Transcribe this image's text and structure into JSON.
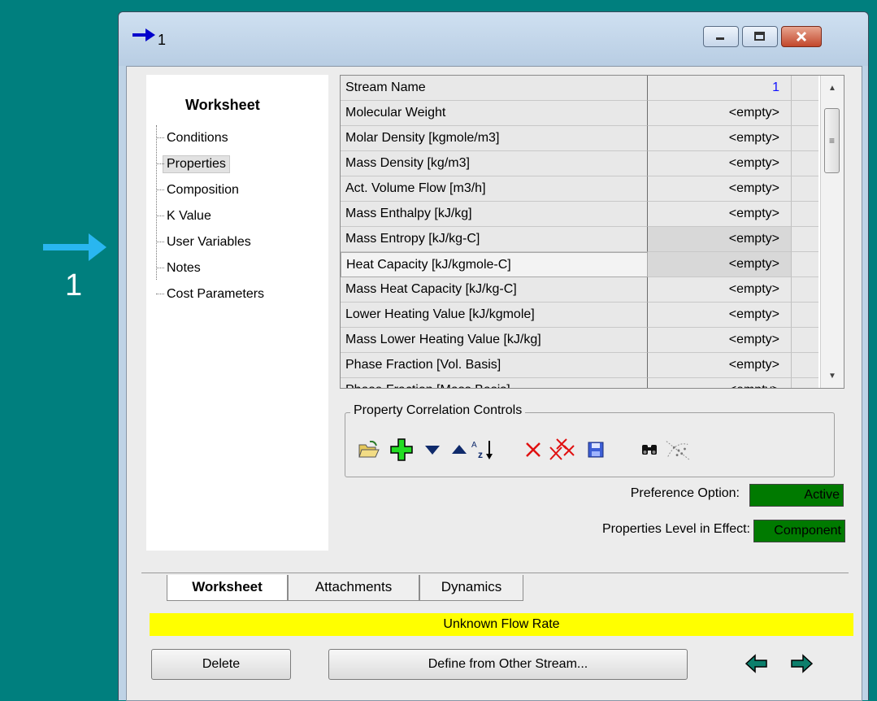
{
  "canvas": {
    "stream_label": "1"
  },
  "window": {
    "title": "1",
    "controls": {
      "minimize": "minimize-icon",
      "maximize": "maximize-icon",
      "close": "close-icon"
    }
  },
  "nav": {
    "header": "Worksheet",
    "items": [
      {
        "label": "Conditions",
        "selected": false
      },
      {
        "label": "Properties",
        "selected": true
      },
      {
        "label": "Composition",
        "selected": false
      },
      {
        "label": "K Value",
        "selected": false
      },
      {
        "label": "User Variables",
        "selected": false
      },
      {
        "label": "Notes",
        "selected": false
      },
      {
        "label": "Cost Parameters",
        "selected": false
      }
    ]
  },
  "grid": {
    "rows": [
      {
        "name": "Stream Name",
        "value": "1"
      },
      {
        "name": "Molecular Weight",
        "value": "<empty>"
      },
      {
        "name": "Molar Density [kgmole/m3]",
        "value": "<empty>"
      },
      {
        "name": "Mass Density [kg/m3]",
        "value": "<empty>"
      },
      {
        "name": "Act. Volume Flow [m3/h]",
        "value": "<empty>"
      },
      {
        "name": "Mass Enthalpy [kJ/kg]",
        "value": "<empty>"
      },
      {
        "name": "Mass Entropy [kJ/kg-C]",
        "value": "<empty>"
      },
      {
        "name": "Heat Capacity [kJ/kgmole-C]",
        "value": "<empty>"
      },
      {
        "name": "Mass Heat Capacity [kJ/kg-C]",
        "value": "<empty>"
      },
      {
        "name": "Lower Heating Value [kJ/kgmole]",
        "value": "<empty>"
      },
      {
        "name": "Mass Lower Heating Value [kJ/kg]",
        "value": "<empty>"
      },
      {
        "name": "Phase Fraction [Vol. Basis]",
        "value": "<empty>"
      },
      {
        "name": "Phase Fraction [Mass Basis]",
        "value": "<empty>"
      }
    ]
  },
  "correlation_controls": {
    "title": "Property Correlation Controls",
    "tools": [
      "open-folder-icon",
      "add-icon",
      "move-down-icon",
      "move-up-icon",
      "sort-az-icon",
      "delete-icon",
      "delete-all-icon",
      "save-icon",
      "binoculars-icon",
      "scatter-icon"
    ]
  },
  "preference": {
    "label": "Preference Option:",
    "value": "Active"
  },
  "properties_level": {
    "label": "Properties Level in Effect:",
    "value": "Component"
  },
  "tabs": [
    {
      "label": "Worksheet",
      "active": true
    },
    {
      "label": "Attachments",
      "active": false
    },
    {
      "label": "Dynamics",
      "active": false
    }
  ],
  "status": "Unknown Flow Rate",
  "buttons": {
    "delete": "Delete",
    "define": "Define from Other Stream..."
  },
  "colors": {
    "canvas": "#007f7e",
    "stream_arrow": "#29b6f0",
    "status": "#ffff00",
    "green_field": "#007a00"
  }
}
